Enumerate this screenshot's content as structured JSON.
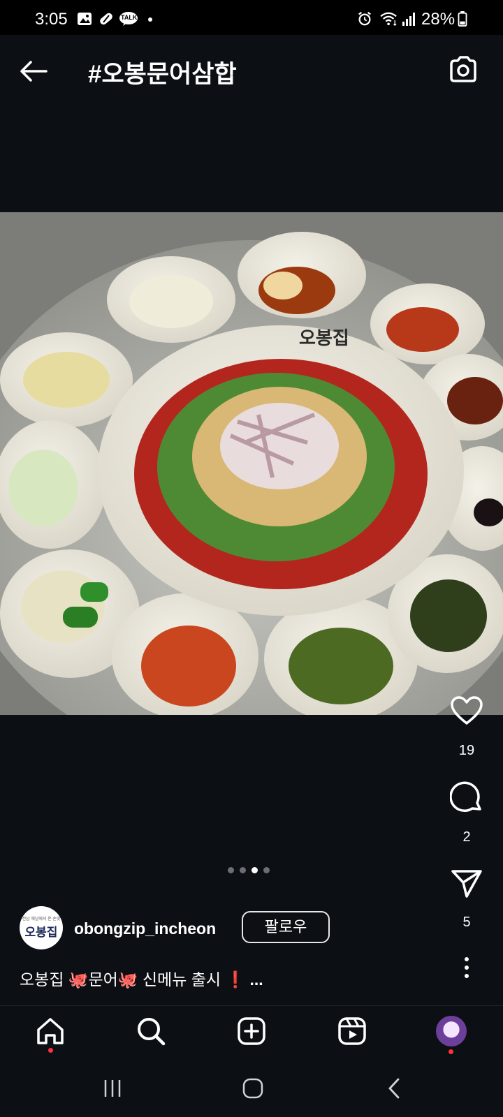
{
  "status_bar": {
    "time": "3:05",
    "battery": "28%",
    "left_icons": [
      "gallery-icon",
      "pill-icon",
      "kakaotalk-icon",
      "notification-dot"
    ],
    "right_icons": [
      "alarm-icon",
      "wifi-icon",
      "signal-icon",
      "battery-icon"
    ],
    "kakao_label": "TALK"
  },
  "header": {
    "title": "#오봉문어삼합",
    "back_icon": "arrow-left-icon",
    "camera_icon": "camera-icon"
  },
  "post": {
    "photo_description_icon": "food-photo",
    "bowl_brand_text": "오봉집",
    "likes": "19",
    "comments": "2",
    "shares": "5",
    "carousel": {
      "total": 4,
      "active_index": 2
    },
    "author": {
      "username": "obongzip_incheon",
      "avatar_text": "오봉집",
      "avatar_subtext": "전남 해남에서 온 손맛"
    },
    "follow_label": "팔로우",
    "caption": {
      "prefix": "오봉집 ",
      "emoji1": "🐙",
      "word": "문어",
      "emoji2": "🐙",
      "suffix": " 신메뉴 출시 ",
      "emoji3": "❗",
      "more": " ..."
    }
  },
  "bottom_nav": {
    "items": [
      "home-icon",
      "search-icon",
      "create-icon",
      "reels-icon",
      "profile-avatar"
    ]
  },
  "system_nav": {
    "items": [
      "recent-apps-icon",
      "home-circle-icon",
      "back-chevron-icon"
    ]
  },
  "colors": {
    "background": "#0c1014",
    "notification_dot": "#ff3040",
    "sauce_red": "#b3261e"
  }
}
